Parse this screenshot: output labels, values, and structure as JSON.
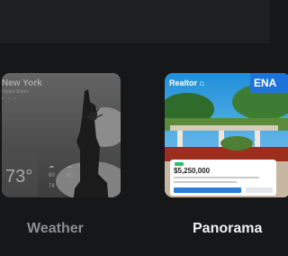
{
  "cards": [
    {
      "label": "Weather",
      "preview": {
        "city": "New York",
        "country": "United States",
        "temperature": "73°",
        "forecast": [
          "80",
          "80",
          "74"
        ]
      }
    },
    {
      "label": "Panorama",
      "badge": "ENA",
      "preview": {
        "brand": "Realtor",
        "price": "$5,250,000"
      }
    }
  ],
  "colors": {
    "background": "#161719",
    "badge": "#1e73d8",
    "label_active": "#f1f1f1",
    "label_inactive": "#8c8d90"
  }
}
